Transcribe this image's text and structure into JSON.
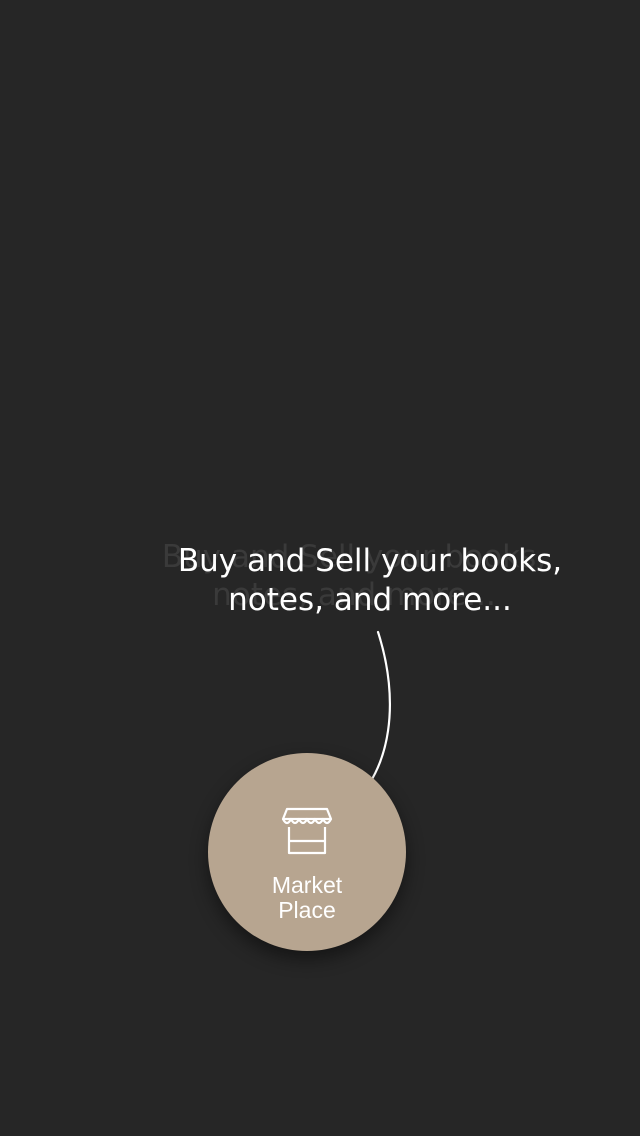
{
  "onboarding": {
    "tooltip_text": "Buy and Sell your books,\nnotes, and more...",
    "ghost_text": "Buy and Sell your books,\nnotes, and more..."
  },
  "market_button": {
    "label": "Market\nPlace",
    "icon": "storefront-icon"
  },
  "colors": {
    "background": "#262626",
    "button": "#b7a590",
    "text": "#ffffff"
  }
}
